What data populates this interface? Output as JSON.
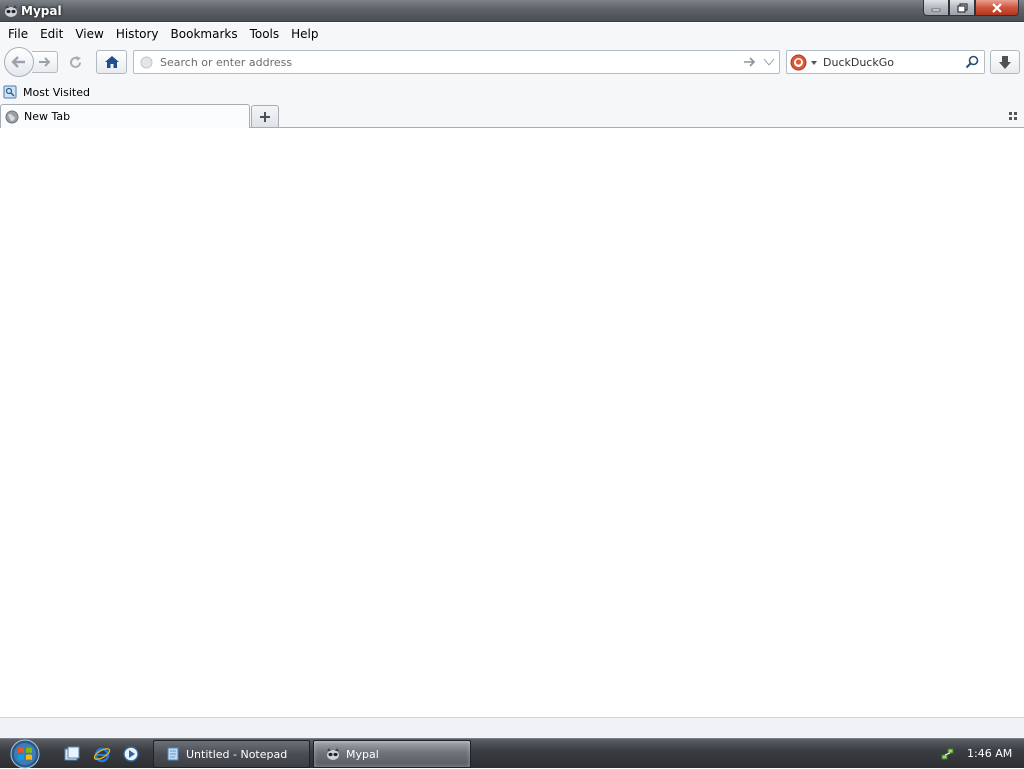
{
  "window": {
    "title": "Mypal"
  },
  "menu": [
    {
      "label": "File"
    },
    {
      "label": "Edit"
    },
    {
      "label": "View"
    },
    {
      "label": "History"
    },
    {
      "label": "Bookmarks"
    },
    {
      "label": "Tools"
    },
    {
      "label": "Help"
    }
  ],
  "navbar": {
    "url_placeholder": "Search or enter address",
    "url_value": "",
    "search_engine": "DuckDuckGo",
    "search_placeholder": "DuckDuckGo"
  },
  "bookmarks": {
    "items": [
      {
        "label": "Most Visited",
        "icon": "most-visited-icon"
      }
    ]
  },
  "tabs": [
    {
      "label": "New Tab",
      "selected": true
    }
  ],
  "taskbar": {
    "tasks": [
      {
        "label": "Untitled - Notepad",
        "icon": "notepad-icon",
        "active": false
      },
      {
        "label": "Mypal",
        "icon": "mypal-icon",
        "active": true
      }
    ],
    "clock": "1:46 AM"
  },
  "colors": {
    "home_icon": "#1e4f8f",
    "duckduckgo": "#de5833",
    "title_bar": "#5d6268"
  }
}
